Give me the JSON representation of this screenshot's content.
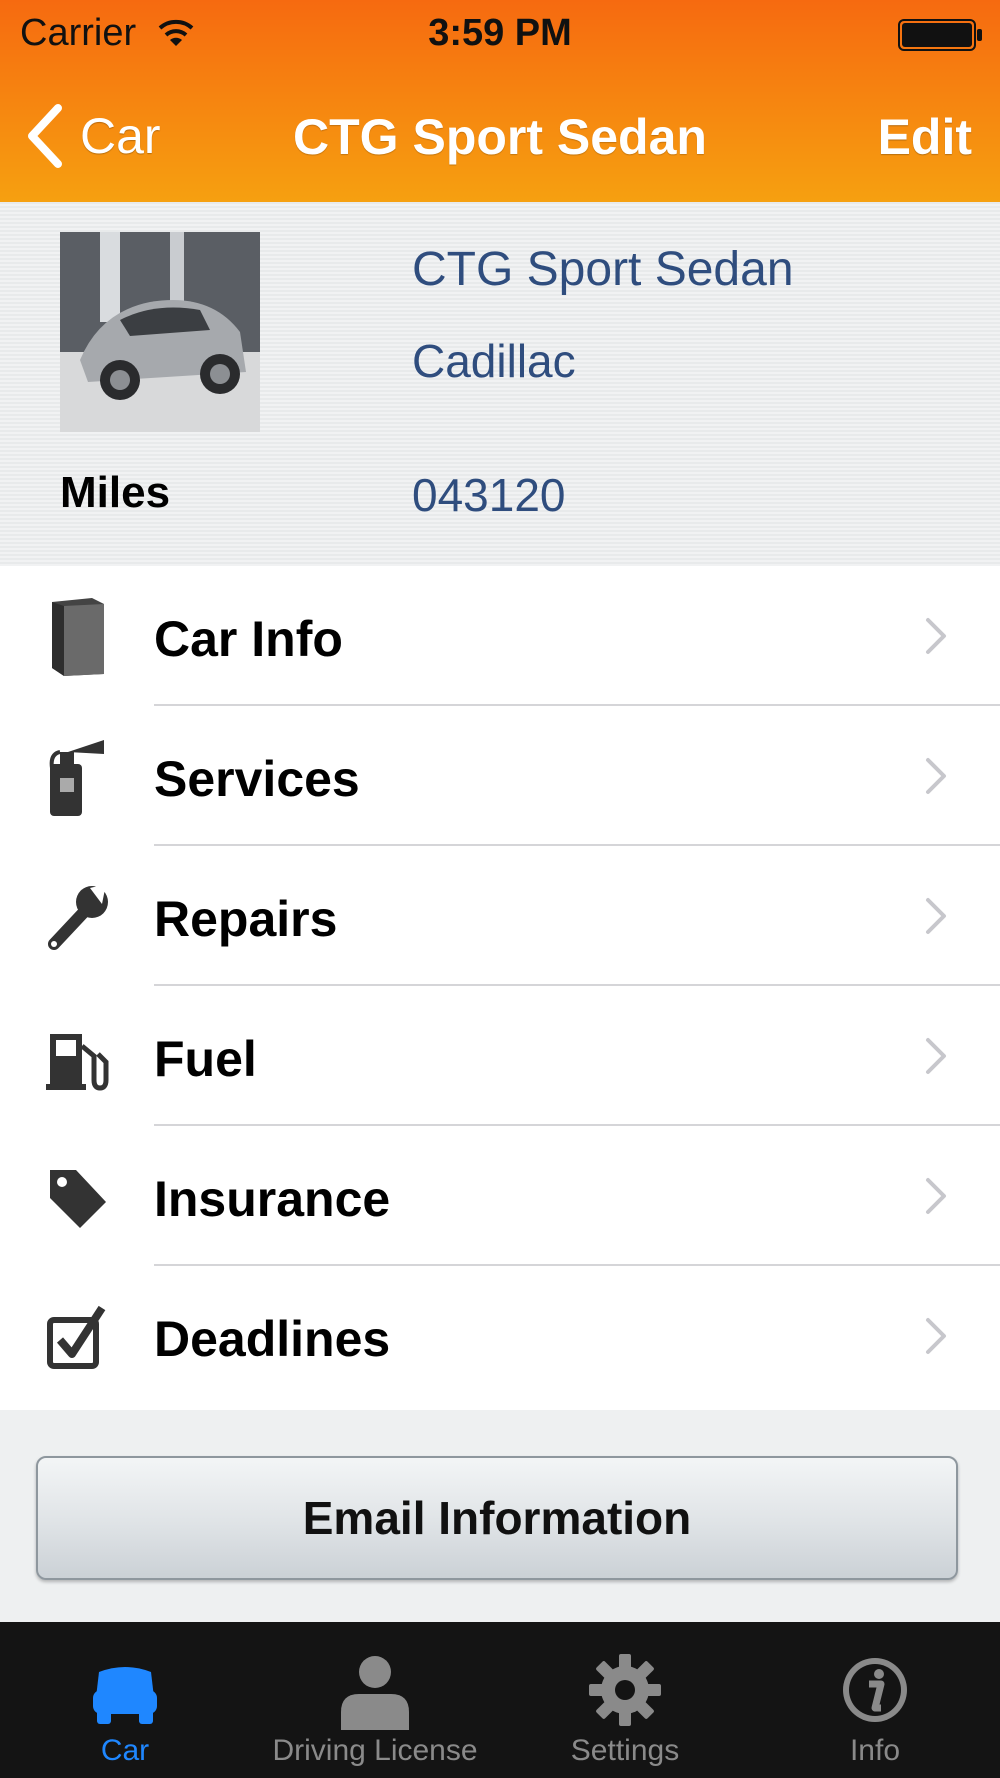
{
  "status_bar": {
    "carrier": "Carrier",
    "time": "3:59 PM"
  },
  "nav": {
    "back_label": "Car",
    "title": "CTG Sport Sedan",
    "edit_label": "Edit"
  },
  "car": {
    "name": "CTG Sport Sedan",
    "make": "Cadillac",
    "miles_label": "Miles",
    "miles_value": "043120"
  },
  "menu": {
    "items": [
      {
        "label": "Car Info",
        "icon": "book-icon"
      },
      {
        "label": "Services",
        "icon": "fire-extinguisher-icon"
      },
      {
        "label": "Repairs",
        "icon": "wrench-icon"
      },
      {
        "label": "Fuel",
        "icon": "fuel-pump-icon"
      },
      {
        "label": "Insurance",
        "icon": "tag-icon"
      },
      {
        "label": "Deadlines",
        "icon": "checkbox-icon"
      }
    ]
  },
  "email_button": {
    "label": "Email Information"
  },
  "tabbar": {
    "tabs": [
      {
        "label": "Car",
        "icon": "car-icon",
        "active": true
      },
      {
        "label": "Driving License",
        "icon": "person-icon",
        "active": false
      },
      {
        "label": "Settings",
        "icon": "gear-icon",
        "active": false
      },
      {
        "label": "Info",
        "icon": "info-icon",
        "active": false
      }
    ]
  },
  "colors": {
    "header_start": "#f66a10",
    "header_end": "#f6a010",
    "link_blue": "#2f4d7e",
    "tab_active": "#1f87ff"
  }
}
